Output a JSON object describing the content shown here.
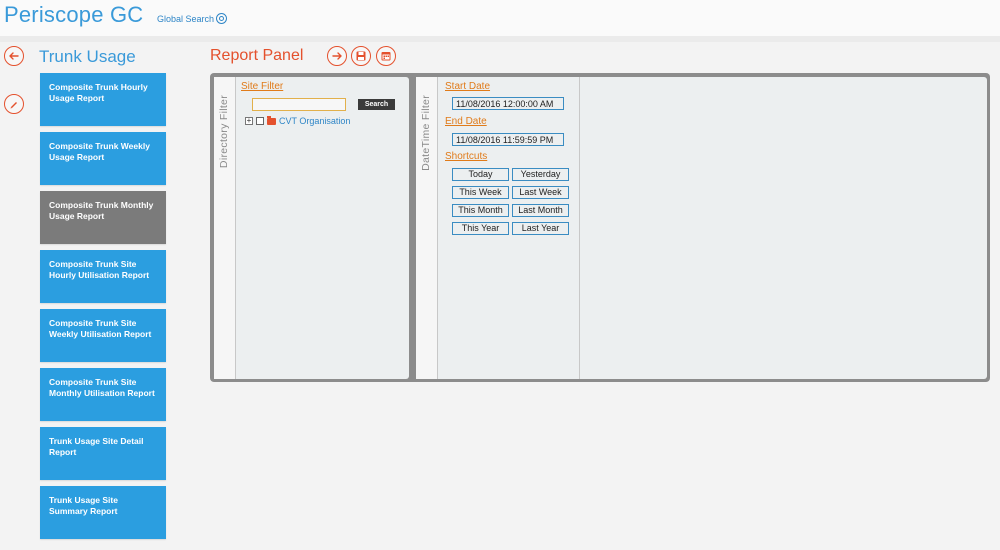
{
  "header": {
    "app_title": "Periscope GC",
    "global_search_label": "Global Search"
  },
  "sidebar": {
    "section_title": "Trunk Usage",
    "reports": [
      {
        "label": "Composite Trunk Hourly Usage Report",
        "active": false
      },
      {
        "label": "Composite Trunk Weekly Usage Report",
        "active": false
      },
      {
        "label": "Composite Trunk Monthly Usage Report",
        "active": true
      },
      {
        "label": "Composite Trunk Site Hourly Utilisation Report",
        "active": false
      },
      {
        "label": "Composite Trunk Site Weekly Utilisation Report",
        "active": false
      },
      {
        "label": "Composite Trunk Site Monthly Utilisation Report",
        "active": false
      },
      {
        "label": "Trunk Usage Site Detail Report",
        "active": false
      },
      {
        "label": "Trunk Usage Site Summary Report",
        "active": false
      }
    ]
  },
  "panel": {
    "title": "Report Panel",
    "directory_filter": {
      "tab_label": "Directory Filter",
      "site_filter_label": "Site Filter",
      "search_value": "",
      "search_button": "Search",
      "tree_root_label": "CVT Organisation",
      "tree_expand_glyph": "+"
    },
    "datetime_filter": {
      "tab_label": "DateTime Filter",
      "start_date_label": "Start Date",
      "start_date_value": "11/08/2016 12:00:00 AM",
      "end_date_label": "End Date",
      "end_date_value": "11/08/2016 11:59:59 PM",
      "shortcuts_label": "Shortcuts",
      "shortcuts": [
        "Today",
        "Yesterday",
        "This Week",
        "Last Week",
        "This Month",
        "Last Month",
        "This Year",
        "Last Year"
      ]
    }
  },
  "icons": {
    "back": "arrow-left-icon",
    "edit": "pencil-icon",
    "run": "arrow-right-icon",
    "save": "floppy-disk-icon",
    "schedule": "calendar-icon",
    "search": "magnifier-icon",
    "folder": "folder-icon"
  },
  "colors": {
    "brand_blue": "#3a9ad9",
    "tile_blue": "#2b9ee0",
    "tile_active": "#7b7b7b",
    "accent_orange": "#e4512d",
    "link_orange": "#e07b1a"
  }
}
